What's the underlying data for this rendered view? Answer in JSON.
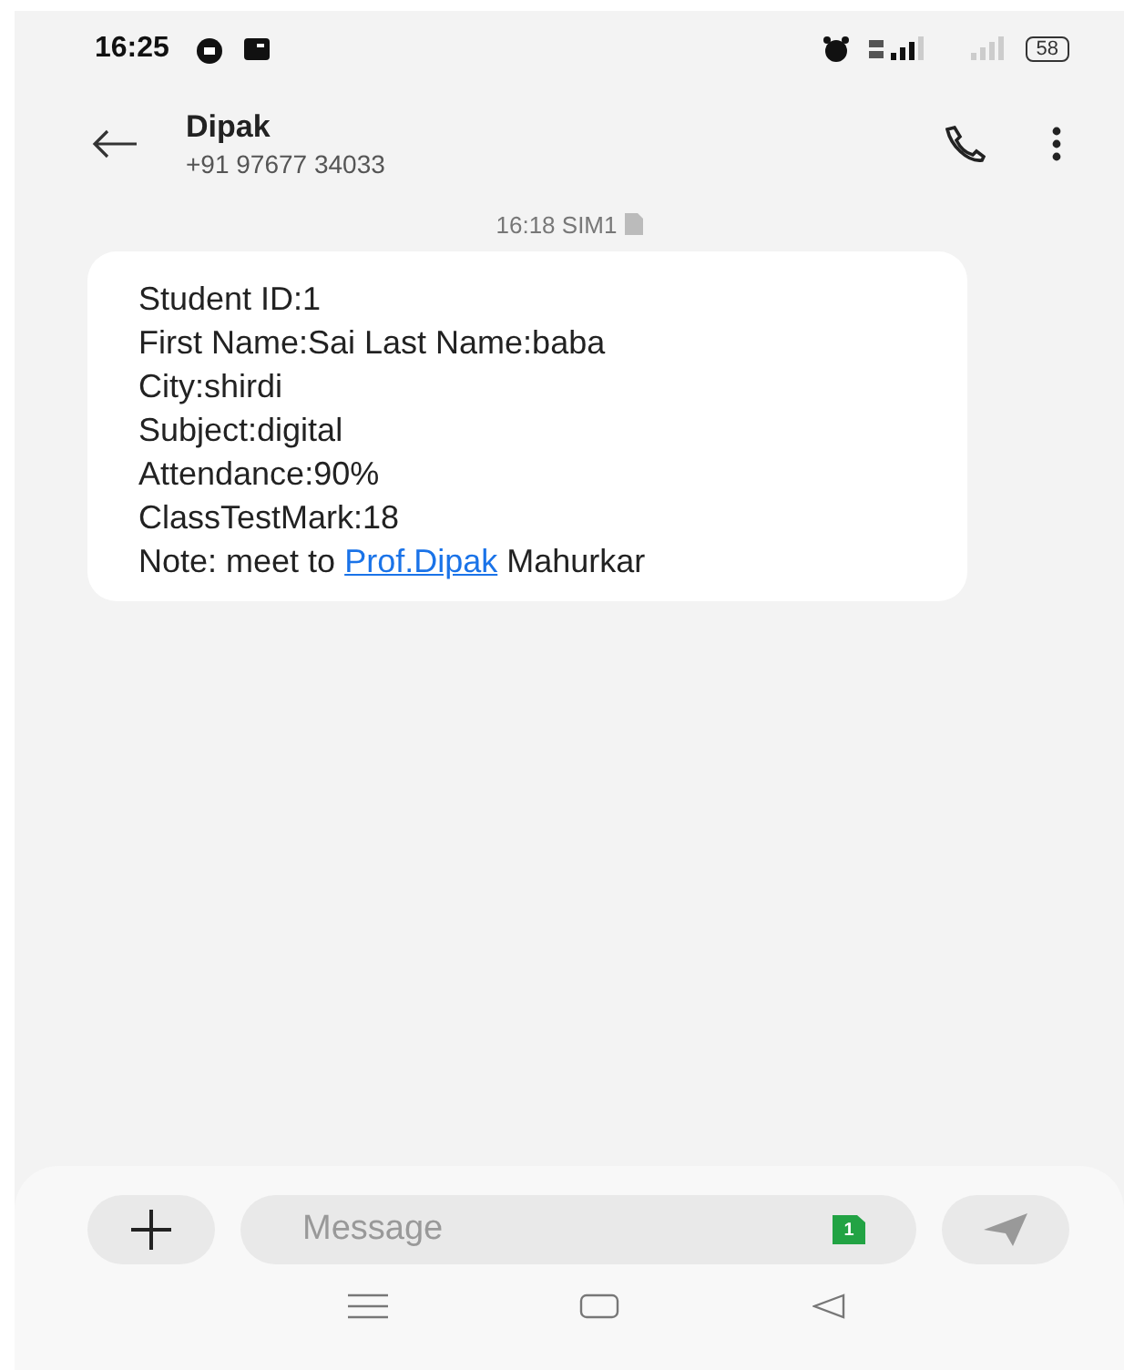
{
  "status_bar": {
    "time": "16:25",
    "battery": "58"
  },
  "header": {
    "name": "Dipak",
    "number": "+91 97677 34033"
  },
  "timestamp": "16:18 SIM1",
  "message": {
    "lines": [
      {
        "kind": "plain",
        "text": "Student ID:1"
      },
      {
        "kind": "plain",
        "text": "First Name:Sai Last Name:baba"
      },
      {
        "kind": "plain",
        "text": "City:shirdi"
      },
      {
        "kind": "plain",
        "text": "Subject:digital"
      },
      {
        "kind": "plain",
        "text": "Attendance:90%"
      },
      {
        "kind": "plain",
        "text": "ClassTestMark:18"
      },
      {
        "kind": "link",
        "before": "Note: meet to ",
        "link": "Prof.Dipak",
        "after": " Mahurkar"
      }
    ]
  },
  "composer": {
    "placeholder": "Message",
    "sim": "1"
  }
}
